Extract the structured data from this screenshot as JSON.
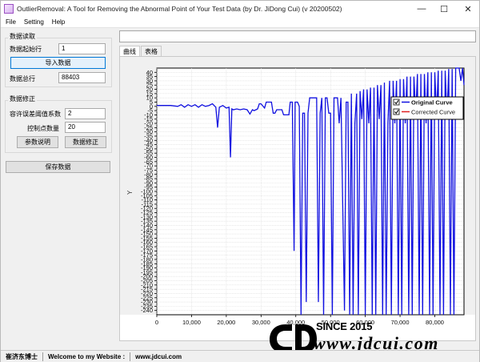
{
  "titlebar": {
    "title": "OutlierRemoval: A Tool for Removing the Abnormal Point of Your Test Data (by Dr. JiDong Cui) (v 20200502)",
    "buttons": {
      "minimize": "—",
      "maximize": "☐",
      "close": "✕"
    }
  },
  "menu": {
    "items": [
      {
        "label": "File"
      },
      {
        "label": "Setting"
      },
      {
        "label": "Help"
      }
    ]
  },
  "left_panel": {
    "read_section": {
      "title": "数据读取",
      "start_row_label": "数据起始行",
      "start_row_value": "1",
      "import_button": "导入数据",
      "total_label": "数据总行",
      "total_value": "88403"
    },
    "correct_section": {
      "title": "数据修正",
      "tolerance_label": "容许误差阈值系数",
      "tolerance_value": "2",
      "control_points_label": "控制点数量",
      "control_points_value": "20",
      "param_help_button": "参数说明",
      "correct_button": "数据修正"
    },
    "save_button": "保存数据"
  },
  "main": {
    "top_field_value": "",
    "tabs": [
      {
        "label": "曲线"
      },
      {
        "label": "表格"
      }
    ]
  },
  "chart_data": {
    "type": "line",
    "ylabel": "Y",
    "xlabel": "",
    "xlim": [
      0,
      88403
    ],
    "ylim": [
      -245,
      45
    ],
    "xticks": [
      0,
      10000,
      20000,
      30000,
      40000,
      50000,
      60000,
      70000,
      80000
    ],
    "xtick_labels": [
      "0",
      "10,000",
      "20,000",
      "30,000",
      "40,000",
      "50,000",
      "60,000",
      "70,000",
      "80,000"
    ],
    "yticks": [
      40,
      35,
      30,
      25,
      20,
      15,
      10,
      5,
      0,
      -5,
      -10,
      -15,
      -20,
      -25,
      -30,
      -35,
      -40,
      -45,
      -50,
      -55,
      -60,
      -65,
      -70,
      -75,
      -80,
      -85,
      -90,
      -95,
      -100,
      -105,
      -110,
      -115,
      -120,
      -125,
      -130,
      -135,
      -140,
      -145,
      -150,
      -155,
      -160,
      -165,
      -170,
      -175,
      -180,
      -185,
      -190,
      -195,
      -200,
      -205,
      -210,
      -215,
      -220,
      -225,
      -230,
      -235,
      -240
    ],
    "legend": {
      "placement": "top-right",
      "entries": [
        {
          "name": "Original Curve",
          "color": "#1010e0",
          "checked": true
        },
        {
          "name": "Corrected Curve",
          "color": "#e02020",
          "checked": true
        }
      ]
    },
    "series": [
      {
        "name": "Original Curve",
        "color": "#1010e0",
        "points": [
          [
            0,
            1
          ],
          [
            4000,
            1
          ],
          [
            6000,
            0
          ],
          [
            7000,
            2
          ],
          [
            8000,
            -1
          ],
          [
            9000,
            2
          ],
          [
            10000,
            0
          ],
          [
            11000,
            2
          ],
          [
            12000,
            -1
          ],
          [
            13000,
            2
          ],
          [
            14000,
            0
          ],
          [
            15000,
            1
          ],
          [
            16000,
            3
          ],
          [
            17000,
            -1
          ],
          [
            17500,
            -25
          ],
          [
            18000,
            -1
          ],
          [
            19000,
            1
          ],
          [
            20000,
            -2
          ],
          [
            20800,
            -1
          ],
          [
            21200,
            -60
          ],
          [
            21600,
            -3
          ],
          [
            22000,
            -4
          ],
          [
            23000,
            -3
          ],
          [
            24000,
            -4
          ],
          [
            25000,
            -3
          ],
          [
            26000,
            -4
          ],
          [
            26800,
            -9
          ],
          [
            27500,
            -4
          ],
          [
            28000,
            -5
          ],
          [
            29000,
            -3
          ],
          [
            29500,
            3
          ],
          [
            30000,
            3
          ],
          [
            31000,
            -2
          ],
          [
            31500,
            5
          ],
          [
            33000,
            5
          ],
          [
            33500,
            -8
          ],
          [
            34000,
            -8
          ],
          [
            34500,
            -4
          ],
          [
            35000,
            -4
          ],
          [
            36000,
            -4
          ],
          [
            36500,
            -10
          ],
          [
            38000,
            -10
          ],
          [
            38400,
            5
          ],
          [
            39000,
            5
          ],
          [
            39500,
            -170
          ],
          [
            39800,
            5
          ],
          [
            40500,
            5
          ],
          [
            41000,
            0
          ],
          [
            41500,
            -245
          ],
          [
            42000,
            -8
          ],
          [
            42500,
            -8
          ],
          [
            43000,
            -230
          ],
          [
            43500,
            -8
          ],
          [
            44000,
            10
          ],
          [
            46000,
            10
          ],
          [
            46500,
            -230
          ],
          [
            47000,
            -8
          ],
          [
            47500,
            10
          ],
          [
            48000,
            -245
          ],
          [
            48500,
            10
          ],
          [
            49000,
            10
          ],
          [
            49500,
            -8
          ],
          [
            50000,
            -8
          ],
          [
            50500,
            -245
          ],
          [
            51000,
            10
          ],
          [
            52000,
            10
          ],
          [
            52500,
            -20
          ],
          [
            53000,
            10
          ],
          [
            54000,
            -240
          ],
          [
            54500,
            5
          ],
          [
            55000,
            5
          ],
          [
            55500,
            -245
          ],
          [
            56000,
            15
          ],
          [
            56500,
            -245
          ],
          [
            57000,
            -20
          ],
          [
            57500,
            15
          ],
          [
            58000,
            -245
          ],
          [
            58500,
            18
          ],
          [
            59000,
            -15
          ],
          [
            59500,
            20
          ],
          [
            60000,
            -245
          ],
          [
            60500,
            20
          ],
          [
            61000,
            -20
          ],
          [
            61500,
            22
          ],
          [
            62000,
            -245
          ],
          [
            62500,
            22
          ],
          [
            63000,
            -245
          ],
          [
            63500,
            25
          ],
          [
            64000,
            -15
          ],
          [
            64500,
            25
          ],
          [
            65000,
            -245
          ],
          [
            65500,
            28
          ],
          [
            66000,
            -245
          ],
          [
            66500,
            -20
          ],
          [
            67000,
            30
          ],
          [
            67500,
            -245
          ],
          [
            68000,
            30
          ],
          [
            68500,
            -20
          ],
          [
            69000,
            30
          ],
          [
            69500,
            -245
          ],
          [
            70000,
            32
          ],
          [
            70500,
            -245
          ],
          [
            71000,
            32
          ],
          [
            71500,
            -20
          ],
          [
            72000,
            35
          ],
          [
            72500,
            -245
          ],
          [
            73000,
            35
          ],
          [
            73500,
            -245
          ],
          [
            74000,
            35
          ],
          [
            74500,
            -10
          ],
          [
            75000,
            38
          ],
          [
            75500,
            -245
          ],
          [
            76000,
            38
          ],
          [
            76500,
            -245
          ],
          [
            77000,
            38
          ],
          [
            77500,
            -20
          ],
          [
            78000,
            40
          ],
          [
            78500,
            -245
          ],
          [
            79000,
            40
          ],
          [
            79500,
            -245
          ],
          [
            80000,
            40
          ],
          [
            80500,
            -10
          ],
          [
            81000,
            42
          ],
          [
            81500,
            -245
          ],
          [
            82000,
            42
          ],
          [
            82500,
            -245
          ],
          [
            83000,
            42
          ],
          [
            83500,
            -15
          ],
          [
            84000,
            44
          ],
          [
            84500,
            -245
          ],
          [
            85000,
            44
          ],
          [
            85500,
            -245
          ],
          [
            86000,
            46
          ],
          [
            87000,
            46
          ],
          [
            87500,
            30
          ],
          [
            88000,
            46
          ],
          [
            88403,
            25
          ]
        ]
      }
    ]
  },
  "statusbar": {
    "author": "崔济东博士",
    "welcome": "Welcome to my Website :",
    "site": "www.jdcui.com"
  },
  "watermark": {
    "since": "SINCE 2015",
    "url": "www.jdcui.com"
  },
  "colors": {
    "accent": "#0078d7",
    "original_curve": "#1010e0",
    "corrected_curve": "#e02020"
  }
}
